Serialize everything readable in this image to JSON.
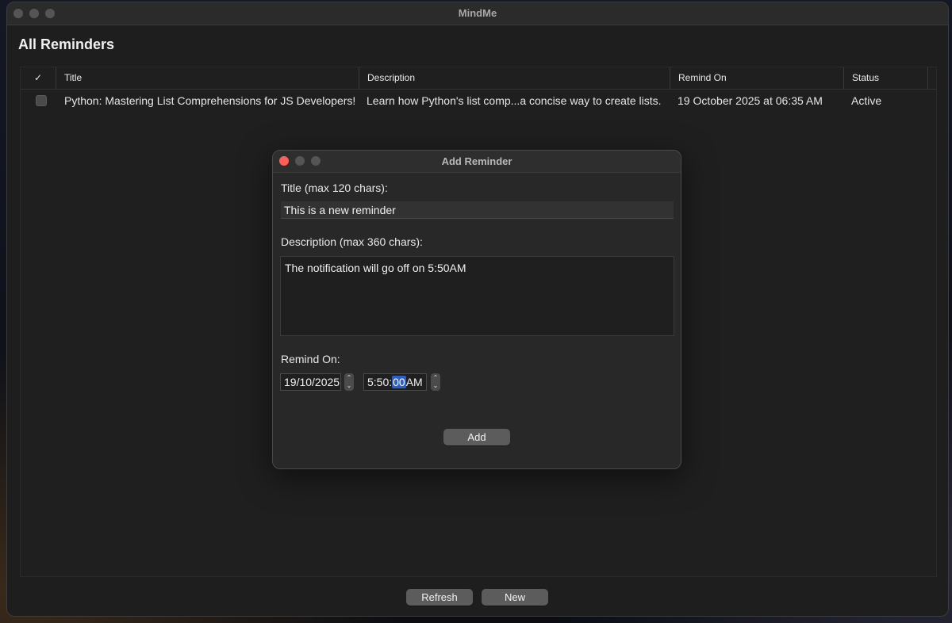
{
  "app": {
    "window_title": "MindMe",
    "page_title": "All Reminders"
  },
  "table": {
    "headers": {
      "check": "✓",
      "title": "Title",
      "description": "Description",
      "remind_on": "Remind On",
      "status": "Status"
    },
    "rows": [
      {
        "checked": false,
        "title": "Python: Mastering List Comprehensions for JS Developers!",
        "description": "Learn how Python's list comp...a concise way to create lists.",
        "remind_on": "19 October 2025 at 06:35 AM",
        "status": "Active"
      }
    ]
  },
  "footer": {
    "refresh_label": "Refresh",
    "new_label": "New"
  },
  "dialog": {
    "title": "Add Reminder",
    "title_label": "Title (max 120 chars):",
    "title_value": "This is a new reminder",
    "description_label": "Description (max 360 chars):",
    "description_value": "The notification will go off on 5:50AM",
    "remind_on_label": "Remind On:",
    "date_value": "19/10/2025",
    "time_hm": "5:50:",
    "time_seconds": "00",
    "time_ampm": "AM",
    "add_label": "Add"
  },
  "icons": {
    "stepper_up": "chevron-up-icon",
    "stepper_down": "chevron-down-icon"
  },
  "colors": {
    "close_light": "#ff5f57",
    "selection": "#2d5fc7",
    "window_bg": "#1e1e1e"
  }
}
